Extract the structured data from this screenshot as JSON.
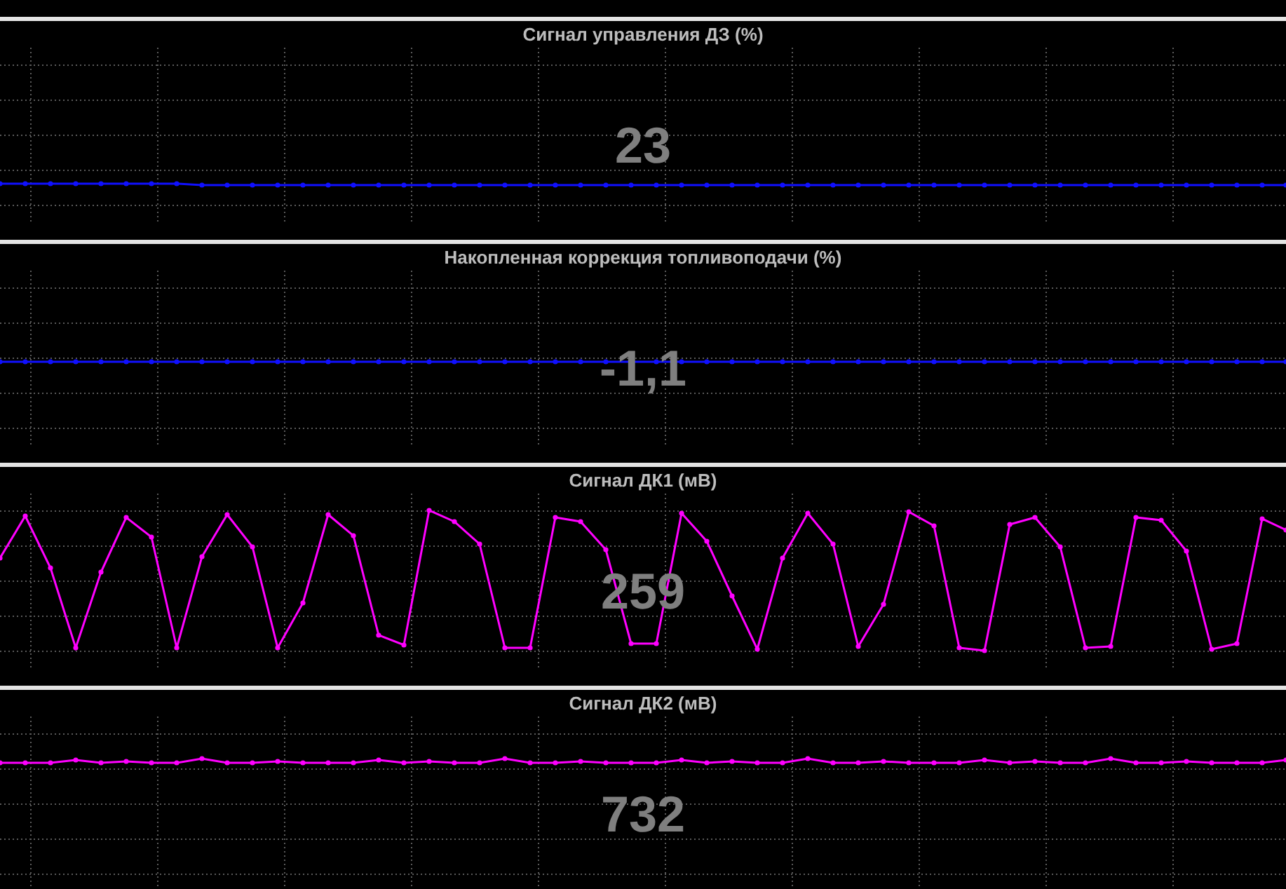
{
  "panels": [
    {
      "kind": "flat_low",
      "title": "Сигнал управления ДЗ (%)",
      "value": "23"
    },
    {
      "kind": "flat_mid",
      "title": "Накопленная коррекция топливоподачи (%)",
      "value": "-1,1"
    },
    {
      "kind": "oscillating",
      "title": "Сигнал ДК1 (мВ)",
      "value": "259"
    },
    {
      "kind": "ripple",
      "title": "Сигнал ДК2 (мВ)",
      "value": "732"
    }
  ]
}
